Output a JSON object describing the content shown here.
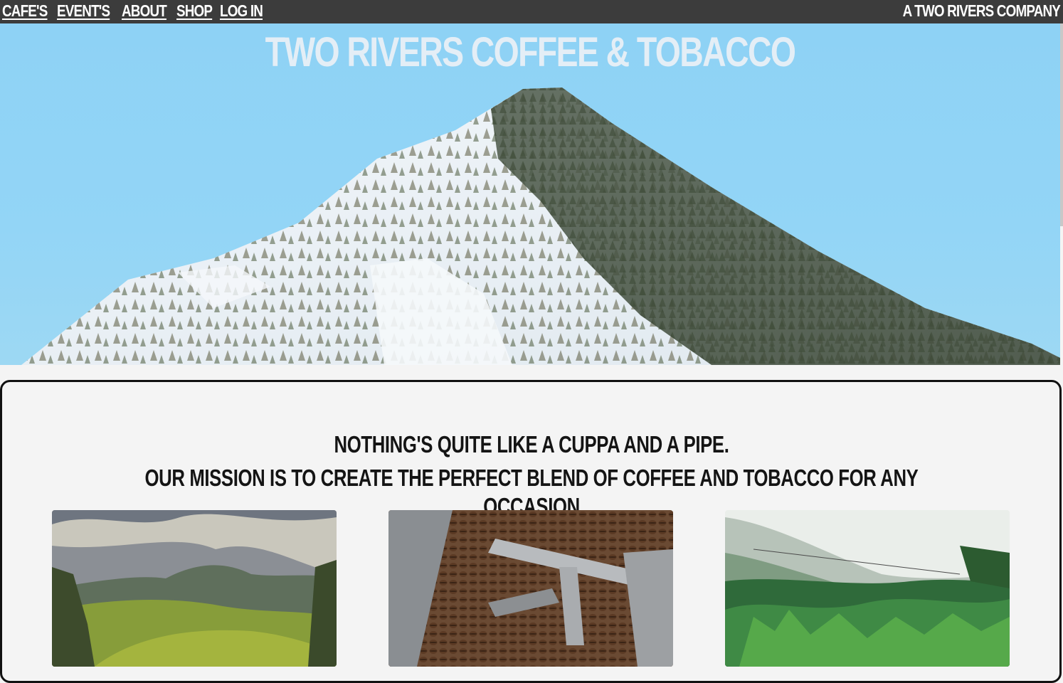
{
  "nav": {
    "links": [
      "CAFE'S",
      "EVENT'S",
      "ABOUT",
      "SHOP",
      "LOG IN"
    ],
    "company": "A TWO RIVERS COMPANY"
  },
  "hero": {
    "title": "TWO RIVERS COFFEE & TOBACCO",
    "image": "snowy-mountain-photo"
  },
  "mission": {
    "line1": "NOTHING'S QUITE LIKE A CUPPA AND A PIPE.",
    "line2": "OUR MISSION IS TO CREATE THE PERFECT BLEND OF COFFEE AND TOBACCO FOR ANY OCCASION"
  },
  "gallery": [
    {
      "image": "tea-plantation-hills-photo"
    },
    {
      "image": "coffee-roaster-beans-photo"
    },
    {
      "image": "tea-leaves-field-photo"
    }
  ]
}
